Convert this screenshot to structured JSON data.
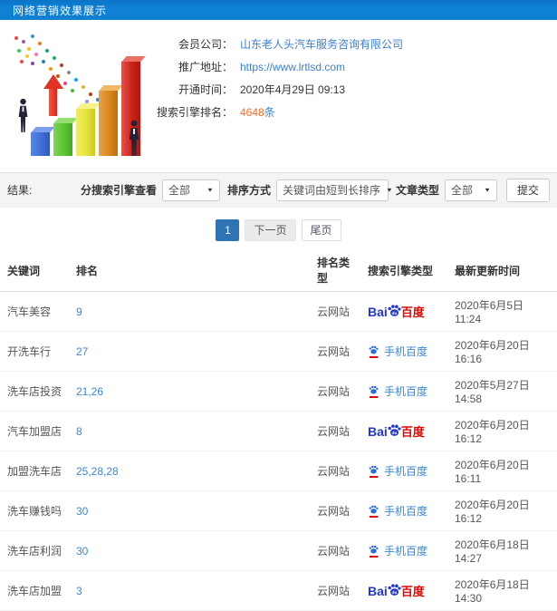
{
  "header": {
    "title": "网络营销效果展示"
  },
  "info": {
    "company_label": "会员公司：",
    "company_value": "山东老人头汽车服务咨询有限公司",
    "url_label": "推广地址：",
    "url_value": "https://www.lrtlsd.com",
    "open_time_label": "开通时间：",
    "open_time_value": "2020年4月29日 09:13",
    "rank_label": "搜索引擎排名：",
    "rank_count": "4648",
    "rank_unit": "条"
  },
  "filters": {
    "result_label": "结果:",
    "engine_filter_label": "分搜索引擎查看",
    "engine_filter_value": "全部",
    "sort_label": "排序方式",
    "sort_value": "关键词由短到长排序",
    "article_type_label": "文章类型",
    "article_type_value": "全部",
    "submit_label": "提交",
    "dropdown_arrow": "▼"
  },
  "pagination": {
    "current": "1",
    "next": "下一页",
    "last": "尾页"
  },
  "table": {
    "columns": [
      "关键词",
      "排名",
      "排名类型",
      "搜索引擎类型",
      "最新更新时间"
    ],
    "logo": {
      "bai": "Bai",
      "du": "du",
      "baidu": "百度",
      "mobile": "手机百度"
    },
    "rows": [
      {
        "keyword": "汽车美容",
        "rank": "9",
        "rank_type": "云网站",
        "engine": "baidu-pc",
        "updated": "2020年6月5日 11:24"
      },
      {
        "keyword": "开洗车行",
        "rank": "27",
        "rank_type": "云网站",
        "engine": "baidu-mobile",
        "updated": "2020年6月20日 16:16"
      },
      {
        "keyword": "洗车店投资",
        "rank": "21,26",
        "rank_type": "云网站",
        "engine": "baidu-mobile",
        "updated": "2020年5月27日 14:58"
      },
      {
        "keyword": "汽车加盟店",
        "rank": "8",
        "rank_type": "云网站",
        "engine": "baidu-pc",
        "updated": "2020年6月20日 16:12"
      },
      {
        "keyword": "加盟洗车店",
        "rank": "25,28,28",
        "rank_type": "云网站",
        "engine": "baidu-mobile",
        "updated": "2020年6月20日 16:11"
      },
      {
        "keyword": "洗车赚钱吗",
        "rank": "30",
        "rank_type": "云网站",
        "engine": "baidu-mobile",
        "updated": "2020年6月20日 16:12"
      },
      {
        "keyword": "洗车店利润",
        "rank": "30",
        "rank_type": "云网站",
        "engine": "baidu-mobile",
        "updated": "2020年6月18日 14:27"
      },
      {
        "keyword": "洗车店加盟",
        "rank": "3",
        "rank_type": "云网站",
        "engine": "baidu-pc",
        "updated": "2020年6月18日 14:30"
      }
    ]
  },
  "colors": {
    "header_bg": "#0e80d2",
    "link_blue": "#3d7fd0",
    "rank_orange": "#ff6a22",
    "baidu_blue": "#2438c8",
    "baidu_red": "#e10601",
    "pagination_active": "#2e74b5"
  }
}
